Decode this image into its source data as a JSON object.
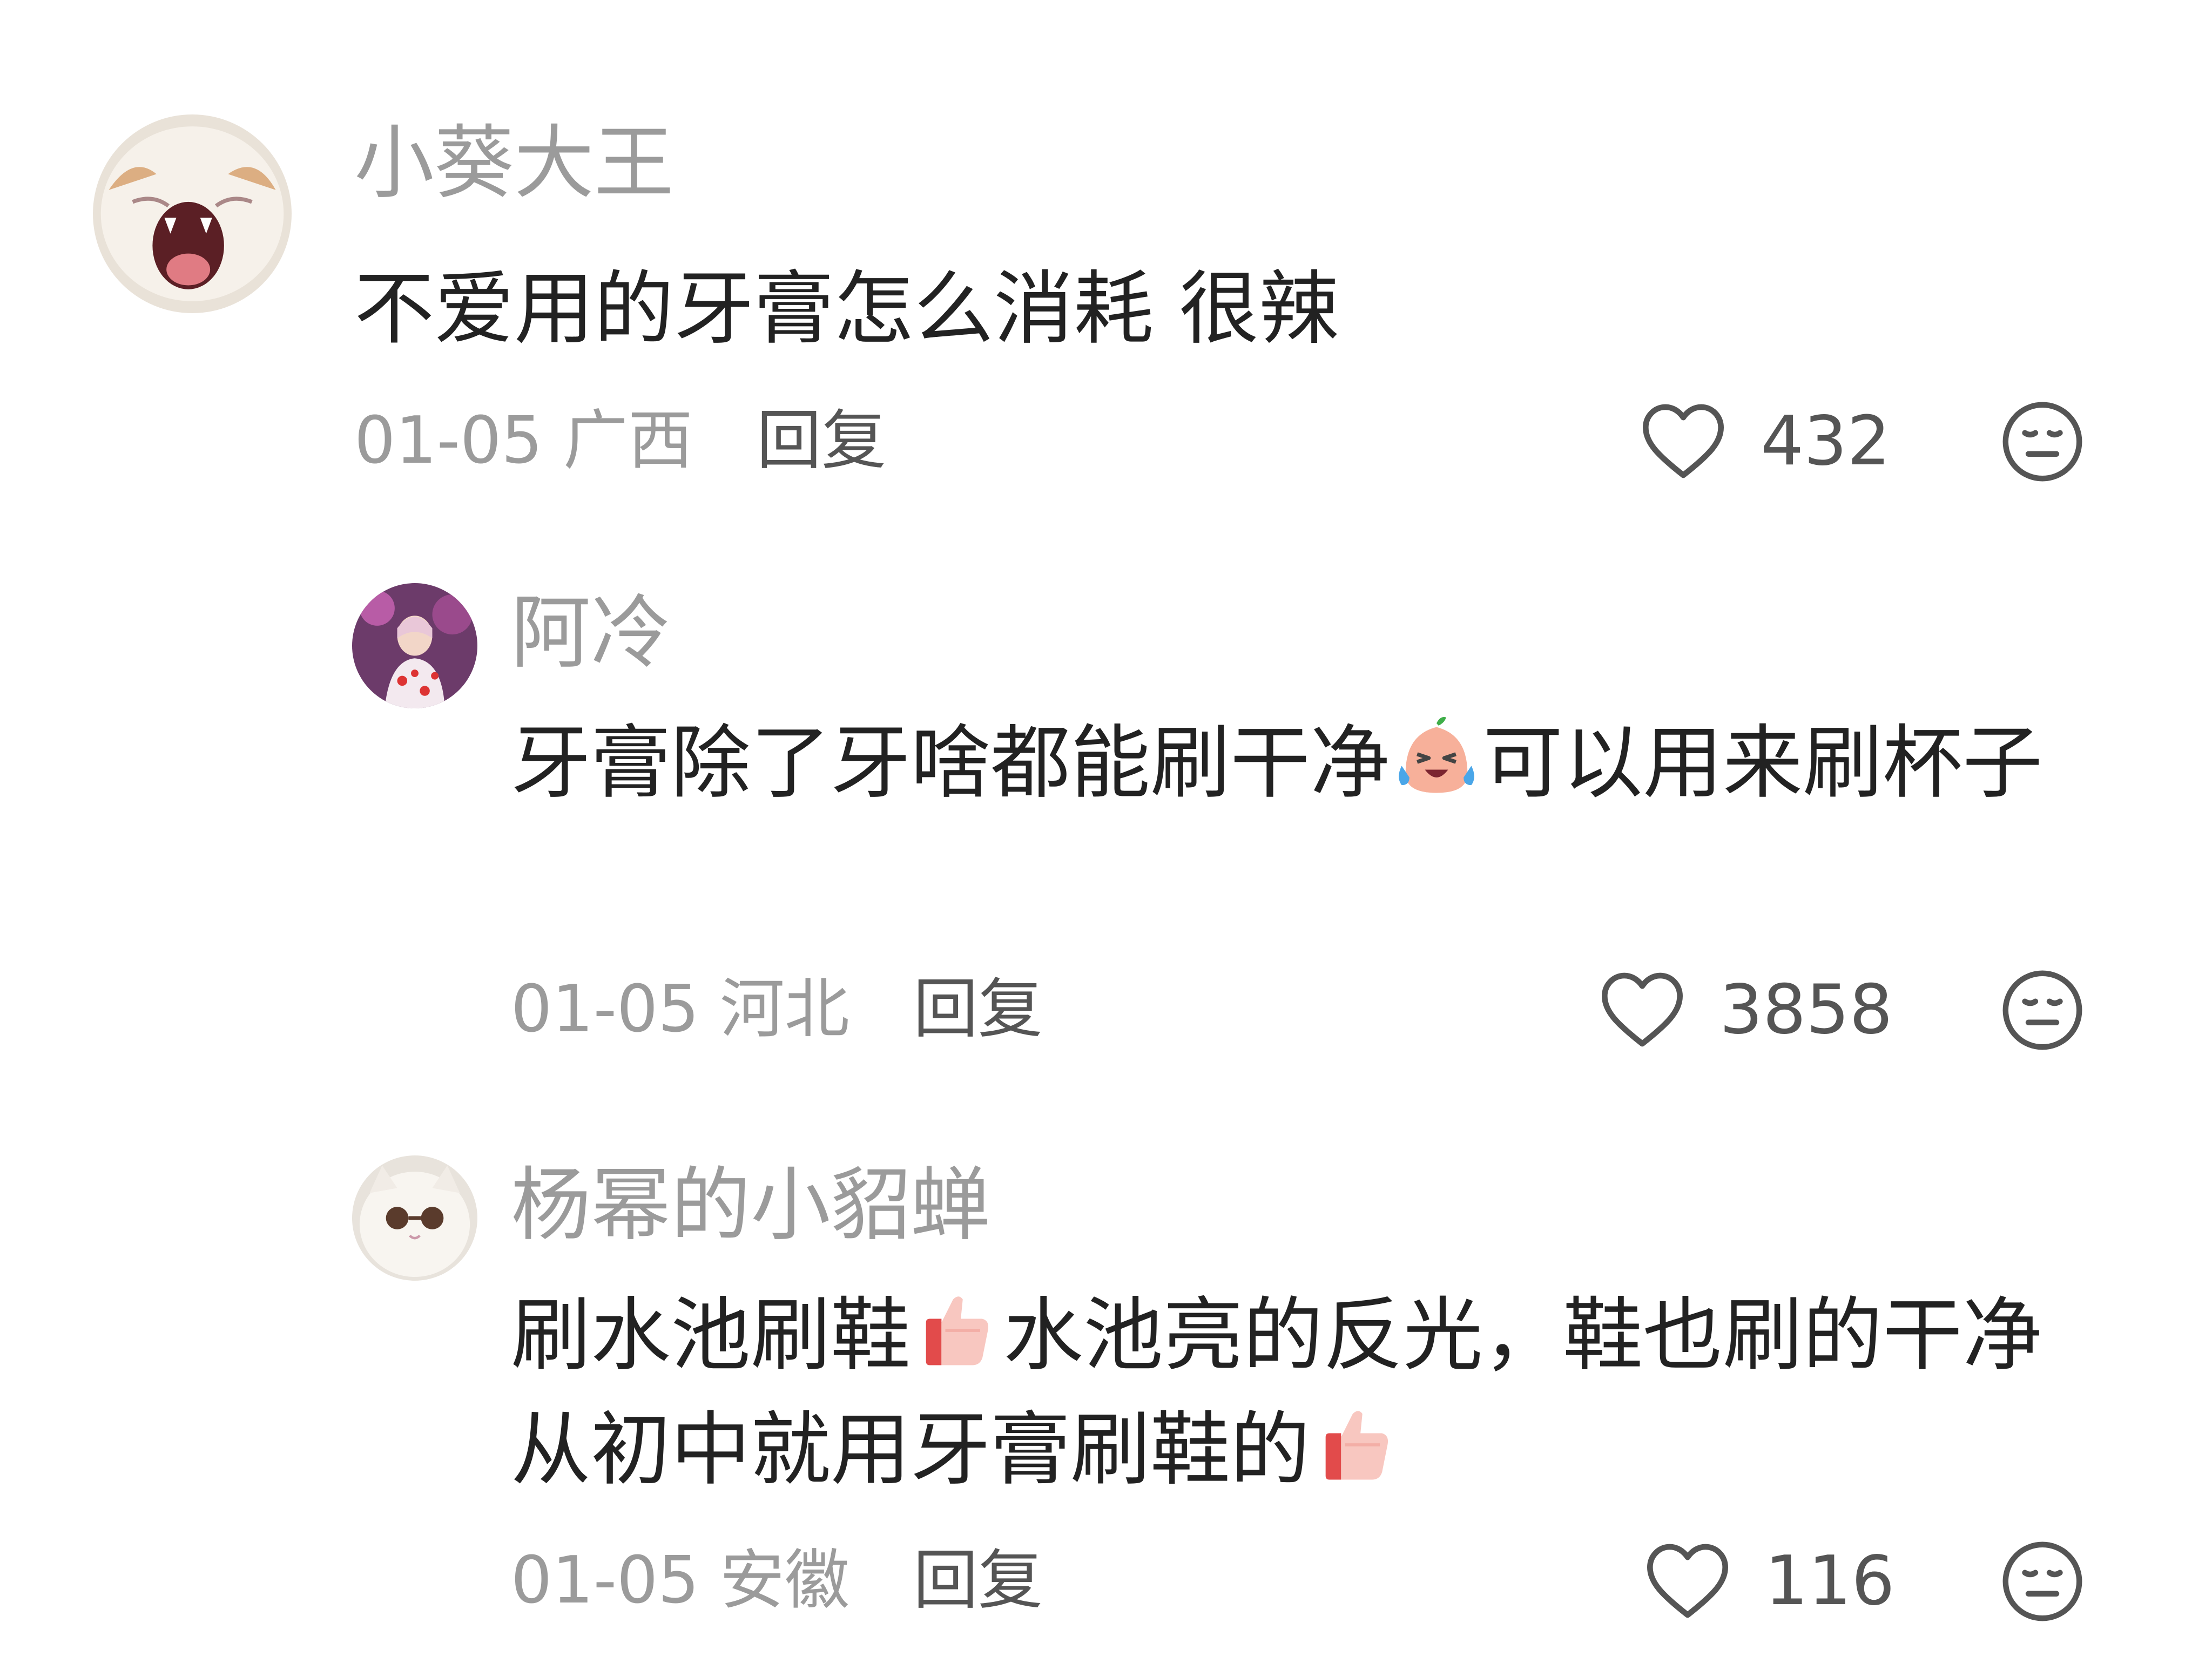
{
  "comments": [
    {
      "username": "小葵大王",
      "text": "不爱用的牙膏怎么消耗 很辣",
      "date": "01-05",
      "location": "广西",
      "reply_label": "回复",
      "likes": "432",
      "avatar": "white-cat-yawning-avatar"
    },
    {
      "username": "阿冷",
      "text_before_emoji": "牙膏除了牙啥都能刷干净",
      "emoji": "laughing-crying-emoji",
      "text_after_emoji": "可以用来刷杯子",
      "date": "01-05",
      "location": "河北",
      "reply_label": "回复",
      "likes": "3858",
      "avatar": "person-with-flowers-avatar"
    },
    {
      "username": "杨幂的小貂蝉",
      "text_part1": "刷水池刷鞋",
      "emoji1": "thumbs-up-emoji",
      "text_part2": "水池亮的反光，鞋也刷的干净从初中就用牙膏刷鞋的",
      "emoji2": "thumbs-up-emoji",
      "date": "01-05",
      "location": "安徽",
      "reply_label": "回复",
      "likes": "116",
      "avatar": "white-cat-sunglasses-avatar"
    }
  ],
  "icons": {
    "like": "heart-outline-icon",
    "dislike": "neutral-face-icon"
  },
  "colors": {
    "username": "#9b9b9b",
    "text": "#222222",
    "meta": "#9b9b9b",
    "reply": "#555555",
    "icon": "#555555"
  }
}
